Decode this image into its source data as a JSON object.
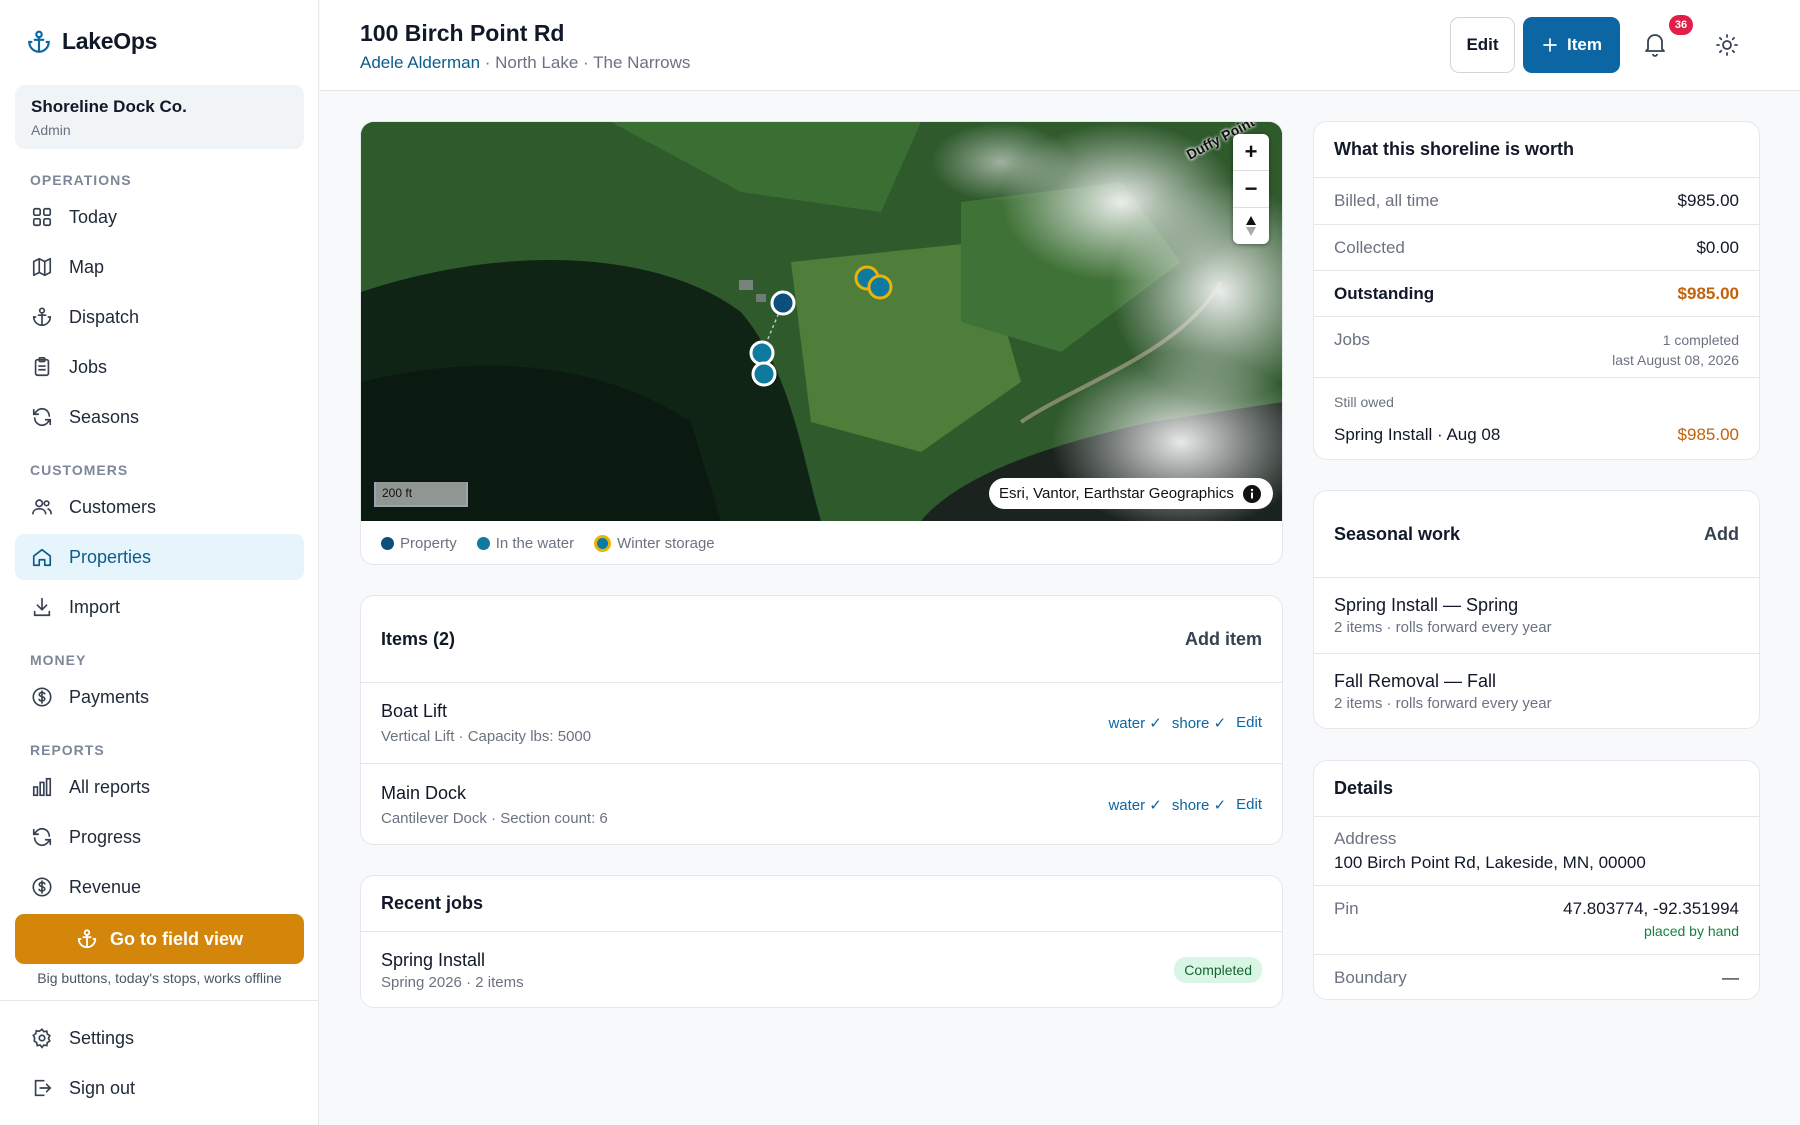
{
  "app": {
    "name": "LakeOps"
  },
  "org": {
    "name": "Shoreline Dock Co.",
    "role": "Admin"
  },
  "sidebar": {
    "sections": [
      "OPERATIONS",
      "CUSTOMERS",
      "MONEY",
      "REPORTS"
    ],
    "items": [
      {
        "label": "Today"
      },
      {
        "label": "Map"
      },
      {
        "label": "Dispatch"
      },
      {
        "label": "Jobs"
      },
      {
        "label": "Seasons"
      },
      {
        "label": "Customers"
      },
      {
        "label": "Properties"
      },
      {
        "label": "Import"
      },
      {
        "label": "Payments"
      },
      {
        "label": "All reports"
      },
      {
        "label": "Progress"
      },
      {
        "label": "Revenue"
      }
    ],
    "field_button": "Go to field view",
    "field_sub": "Big buttons, today's stops, works offline",
    "settings": "Settings",
    "signout": "Sign out"
  },
  "header": {
    "title": "100 Birch Point Rd",
    "owner": "Adele Alderman",
    "location": "· North Lake · The Narrows",
    "edit": "Edit",
    "add_item": "Item",
    "notifications": "36"
  },
  "map": {
    "scale": "200 ft",
    "attribution": "Esri, Vantor, Earthstar Geographics",
    "place_label": "Duffy Point",
    "legend": [
      {
        "label": "Property",
        "color": "#0b4f7a"
      },
      {
        "label": "In the water",
        "color": "#0e7aa0"
      },
      {
        "label": "Winter storage",
        "color": "#0e7aa0",
        "ring": "#eab308"
      }
    ]
  },
  "items_card": {
    "title": "Items (2)",
    "add": "Add item",
    "rows": [
      {
        "name": "Boat Lift",
        "detail": "Vertical Lift · Capacity lbs: 5000",
        "water": "water ✓",
        "shore": "shore ✓",
        "edit": "Edit"
      },
      {
        "name": "Main Dock",
        "detail": "Cantilever Dock · Section count: 6",
        "water": "water ✓",
        "shore": "shore ✓",
        "edit": "Edit"
      }
    ]
  },
  "recent_jobs": {
    "title": "Recent jobs",
    "rows": [
      {
        "name": "Spring Install",
        "detail": "Spring 2026 · 2 items",
        "status": "Completed"
      }
    ]
  },
  "worth": {
    "title": "What this shoreline is worth",
    "billed_label": "Billed, all time",
    "billed": "$985.00",
    "collected_label": "Collected",
    "collected": "$0.00",
    "outstanding_label": "Outstanding",
    "outstanding": "$985.00",
    "jobs_label": "Jobs",
    "jobs_count": "1 completed",
    "jobs_last": "last August 08, 2026",
    "owed_label": "Still owed",
    "owed_item": "Spring Install · Aug 08",
    "owed_amount": "$985.00"
  },
  "seasonal": {
    "title": "Seasonal work",
    "add": "Add",
    "rows": [
      {
        "name": "Spring Install — Spring",
        "detail": "2 items · rolls forward every year"
      },
      {
        "name": "Fall Removal — Fall",
        "detail": "2 items · rolls forward every year"
      }
    ]
  },
  "details": {
    "title": "Details",
    "address_label": "Address",
    "address": "100 Birch Point Rd, Lakeside, MN, 00000",
    "pin_label": "Pin",
    "pin": "47.803774, -92.351994",
    "pin_note": "placed by hand",
    "boundary_label": "Boundary",
    "boundary": "—"
  },
  "colors": {
    "accent": "#0b66a3",
    "field": "#d4860b",
    "outstanding": "#c2620a",
    "active_bg": "#e6f4fb"
  }
}
